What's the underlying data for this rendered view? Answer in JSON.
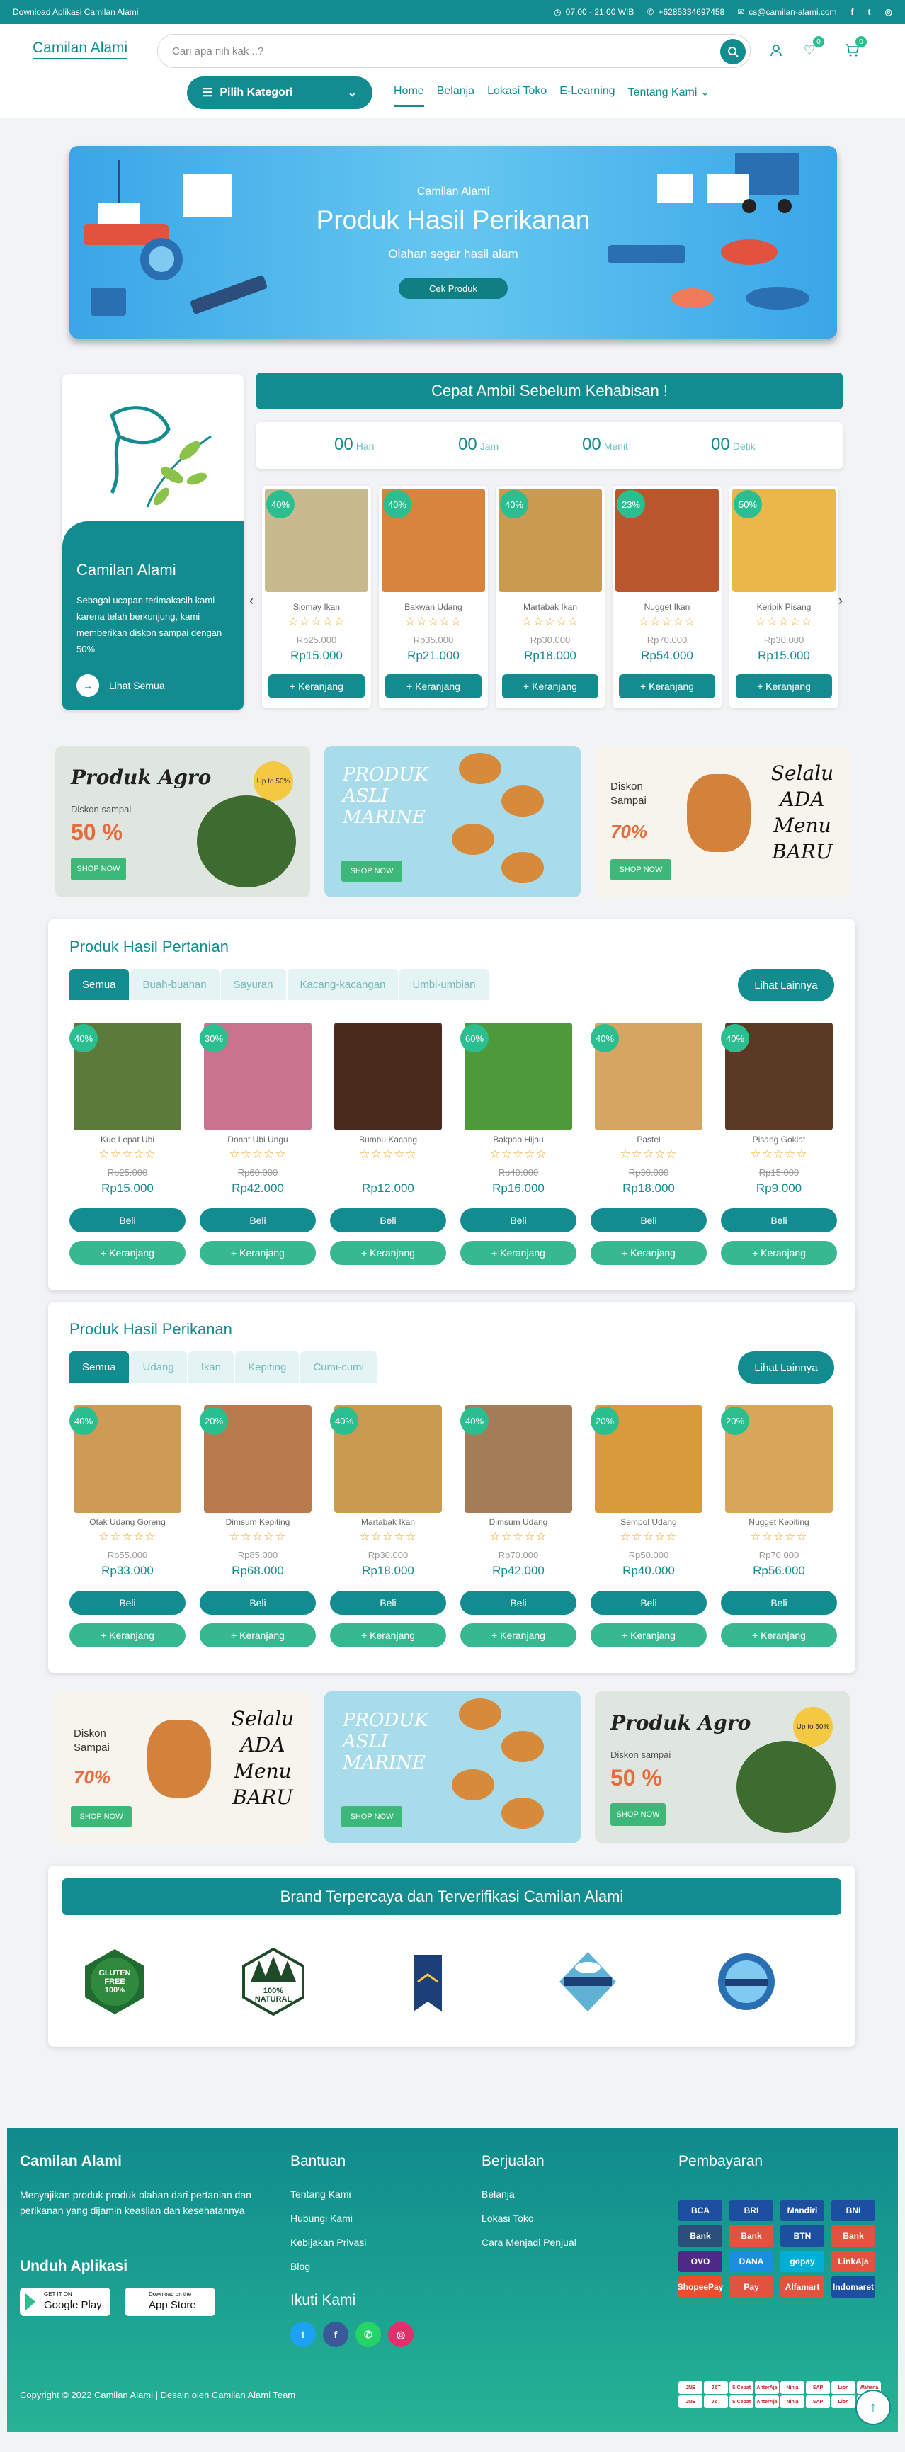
{
  "topbar": {
    "download": "Download Aplikasi Camilan Alami",
    "hours": "07.00 - 21.00 WIB",
    "phone": "+6285334697458",
    "email": "cs@camilan-alami.com"
  },
  "header": {
    "logo": "Camilan Alami",
    "search_placeholder": "Cari apa nih kak ..?",
    "wishlist_count": "0",
    "cart_count": "0",
    "category_button": "Pilih Kategori",
    "nav": [
      "Home",
      "Belanja",
      "Lokasi Toko",
      "E-Learning",
      "Tentang Kami"
    ]
  },
  "hero": {
    "kicker": "Camilan Alami",
    "title": "Produk Hasil Perikanan",
    "subtitle": "Olahan segar hasil alam",
    "cta": "Cek Produk"
  },
  "flash": {
    "title": "Cepat Ambil Sebelum Kehabisan !",
    "card_title": "Camilan Alami",
    "card_text": "Sebagai ucapan terimakasih kami karena telah berkunjung, kami memberikan diskon sampai dengan 50%",
    "see_all": "Lihat Semua",
    "timer": [
      {
        "value": "00",
        "unit": "Hari"
      },
      {
        "value": "00",
        "unit": "Jam"
      },
      {
        "value": "00",
        "unit": "Menit"
      },
      {
        "value": "00",
        "unit": "Detik"
      }
    ],
    "products": [
      {
        "name": "Siomay Ikan",
        "disc": "40%",
        "old": "Rp25.000",
        "price": "Rp15.000",
        "btn": "+ Keranjang",
        "color": "#c9b98e"
      },
      {
        "name": "Bakwan Udang",
        "disc": "40%",
        "old": "Rp35.000",
        "price": "Rp21.000",
        "btn": "+ Keranjang",
        "color": "#d8843f"
      },
      {
        "name": "Martabak Ikan",
        "disc": "40%",
        "old": "Rp30.000",
        "price": "Rp18.000",
        "btn": "+ Keranjang",
        "color": "#c99a4f"
      },
      {
        "name": "Nugget Ikan",
        "disc": "23%",
        "old": "Rp70.000",
        "price": "Rp54.000",
        "btn": "+ Keranjang",
        "color": "#b9562e"
      },
      {
        "name": "Keripik Pisang",
        "disc": "50%",
        "old": "Rp30.000",
        "price": "Rp15.000",
        "btn": "+ Keranjang",
        "color": "#eab84a"
      }
    ]
  },
  "promos": {
    "agro_title": "Produk Agro",
    "agro_disc_label": "Diskon sampai",
    "agro_disc": "50 %",
    "upto": "Up to 50%",
    "marine_text": "PRODUK ASLI MARINE",
    "menu_disc_label": "Diskon Sampai",
    "menu_disc": "70%",
    "menu_text": "Selalu ADA Menu BARU",
    "shop_now": "SHOP NOW"
  },
  "agri": {
    "title": "Produk Hasil Pertanian",
    "tabs": [
      "Semua",
      "Buah-buahan",
      "Sayuran",
      "Kacang-kacangan",
      "Umbi-umbian"
    ],
    "more": "Lihat Lainnya",
    "buy": "Beli",
    "cart": "+ Keranjang",
    "products": [
      {
        "name": "Kue Lepat Ubi",
        "disc": "40%",
        "old": "Rp25.000",
        "price": "Rp15.000",
        "color": "#5c7a3a"
      },
      {
        "name": "Donat Ubi Ungu",
        "disc": "30%",
        "old": "Rp60.000",
        "price": "Rp42.000",
        "color": "#c9748f"
      },
      {
        "name": "Bumbu Kacang",
        "disc": "",
        "old": "",
        "price": "Rp12.000",
        "color": "#4a2a1c"
      },
      {
        "name": "Bakpao Hijau",
        "disc": "60%",
        "old": "Rp40.000",
        "price": "Rp16.000",
        "color": "#4e9a3a"
      },
      {
        "name": "Pastel",
        "disc": "40%",
        "old": "Rp30.000",
        "price": "Rp18.000",
        "color": "#d6a561"
      },
      {
        "name": "Pisang Goklat",
        "disc": "40%",
        "old": "Rp15.000",
        "price": "Rp9.000",
        "color": "#5a3a22"
      }
    ]
  },
  "fish": {
    "title": "Produk Hasil Perikanan",
    "tabs": [
      "Semua",
      "Udang",
      "Ikan",
      "Kepiting",
      "Cumi-cumi"
    ],
    "more": "Lihat Lainnya",
    "buy": "Beli",
    "cart": "+ Keranjang",
    "products": [
      {
        "name": "Otak Udang Goreng",
        "disc": "40%",
        "old": "Rp55.000",
        "price": "Rp33.000",
        "color": "#cf9a55"
      },
      {
        "name": "Dimsum Kepiting",
        "disc": "20%",
        "old": "Rp85.000",
        "price": "Rp68.000",
        "color": "#b97a4d"
      },
      {
        "name": "Martabak Ikan",
        "disc": "40%",
        "old": "Rp30.000",
        "price": "Rp18.000",
        "color": "#c99a4f"
      },
      {
        "name": "Dimsum Udang",
        "disc": "40%",
        "old": "Rp70.000",
        "price": "Rp42.000",
        "color": "#a27d57"
      },
      {
        "name": "Sempol Udang",
        "disc": "20%",
        "old": "Rp50.000",
        "price": "Rp40.000",
        "color": "#d99a3e"
      },
      {
        "name": "Nugget Kepiting",
        "disc": "20%",
        "old": "Rp70.000",
        "price": "Rp56.000",
        "color": "#d9a55a"
      }
    ]
  },
  "brands": {
    "title": "Brand Terpercaya dan Terverifikasi Camilan Alami",
    "gluten": "GLUTEN FREE 100%",
    "natural": "100% NATURAL"
  },
  "footer": {
    "brand": "Camilan Alami",
    "desc": "Menyajikan produk produk olahan dari pertanian dan perikanan yang dijamin keaslian dan kesehatannya",
    "app_title": "Unduh Aplikasi",
    "gplay_small": "GET IT ON",
    "gplay": "Google Play",
    "appstore_small": "Download on the",
    "appstore": "App Store",
    "help_title": "Bantuan",
    "help": [
      "Tentang Kami",
      "Hubungi Kami",
      "Kebijakan Privasi",
      "Blog"
    ],
    "follow_title": "Ikuti Kami",
    "sell_title": "Berjualan",
    "sell": [
      "Belanja",
      "Lokasi Toko",
      "Cara Menjadi Penjual"
    ],
    "pay_title": "Pembayaran",
    "pay": [
      "BCA",
      "BRI",
      "Mandiri",
      "BNI",
      "Bank",
      "Bank",
      "BTN",
      "Bank",
      "OVO",
      "DANA",
      "gopay",
      "LinkAja",
      "ShopeePay",
      "Pay",
      "Alfamart",
      "Indomaret"
    ],
    "couriers": [
      "JNE",
      "J&T",
      "SiCepat",
      "AnterAja",
      "Ninja",
      "SAP",
      "Lion",
      "Wahana",
      "JNE",
      "J&T",
      "SiCepat",
      "AnterAja",
      "Ninja",
      "SAP",
      "Lion",
      "Wahana"
    ],
    "copyright": "Copyright © 2022 Camilan Alami | Desain oleh Camilan Alami Team"
  }
}
